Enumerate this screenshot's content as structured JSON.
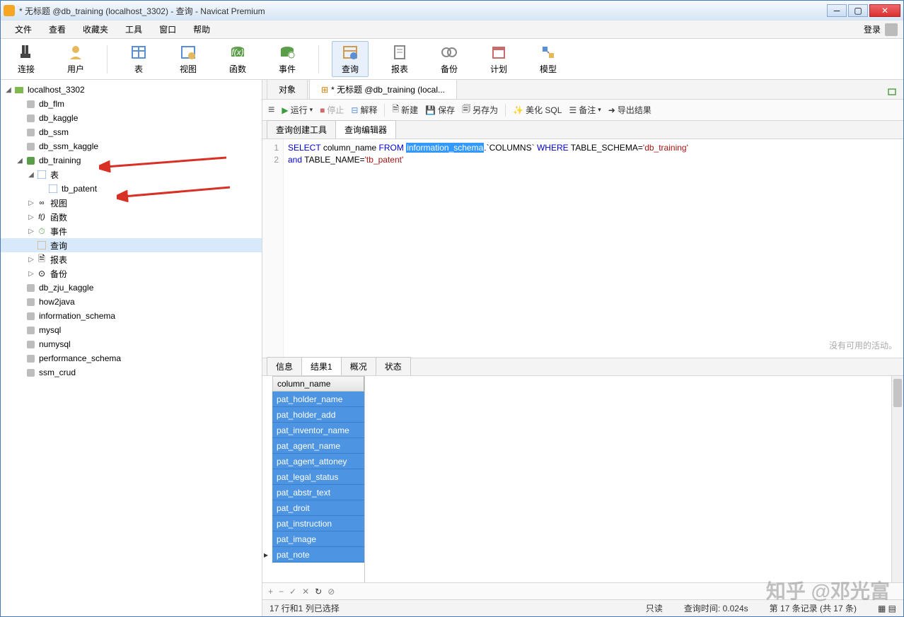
{
  "window": {
    "title": "* 无标题 @db_training (localhost_3302) - 查询 - Navicat Premium"
  },
  "menu": [
    "文件",
    "查看",
    "收藏夹",
    "工具",
    "窗口",
    "帮助"
  ],
  "login_label": "登录",
  "toolbar": [
    {
      "label": "连接",
      "icon": "plug"
    },
    {
      "label": "用户",
      "icon": "user"
    },
    {
      "label": "表",
      "icon": "table"
    },
    {
      "label": "视图",
      "icon": "view"
    },
    {
      "label": "函数",
      "icon": "fx"
    },
    {
      "label": "事件",
      "icon": "event"
    },
    {
      "label": "查询",
      "icon": "query",
      "active": true
    },
    {
      "label": "报表",
      "icon": "report"
    },
    {
      "label": "备份",
      "icon": "backup"
    },
    {
      "label": "计划",
      "icon": "schedule"
    },
    {
      "label": "模型",
      "icon": "model"
    }
  ],
  "tree": {
    "conn": "localhost_3302",
    "dbs_before": [
      "db_flm",
      "db_kaggle",
      "db_ssm",
      "db_ssm_kaggle"
    ],
    "active_db": "db_training",
    "active_nodes": {
      "tables_label": "表",
      "table_name": "tb_patent",
      "views": "视图",
      "functions": "函数",
      "events": "事件",
      "queries": "查询",
      "reports": "报表",
      "backups": "备份"
    },
    "dbs_after": [
      "db_zju_kaggle",
      "how2java",
      "information_schema",
      "mysql",
      "numysql",
      "performance_schema",
      "ssm_crud"
    ]
  },
  "main_tabs": {
    "objects": "对象",
    "query": "* 无标题 @db_training (local..."
  },
  "qtoolbar": {
    "run": "运行",
    "stop": "停止",
    "explain": "解释",
    "new": "新建",
    "save": "保存",
    "saveas": "另存为",
    "beautify": "美化 SQL",
    "notes": "备注",
    "export": "导出结果"
  },
  "subtabs": {
    "builder": "查询创建工具",
    "editor": "查询编辑器"
  },
  "sql": {
    "line1_a": "SELECT",
    "line1_b": "column_name",
    "line1_c": "FROM",
    "line1_hl": "information_schema",
    "line1_d": ".`COLUMNS`",
    "line1_e": "WHERE",
    "line1_f": "TABLE_SCHEMA=",
    "line1_g": "'db_training'",
    "line2_a": "and",
    "line2_b": "TABLE_NAME=",
    "line2_c": "'tb_patent'"
  },
  "result_tabs": [
    "信息",
    "结果1",
    "概况",
    "状态"
  ],
  "result_header": "column_name",
  "result_rows": [
    "pat_holder_name",
    "pat_holder_add",
    "pat_inventor_name",
    "pat_agent_name",
    "pat_agent_attoney",
    "pat_legal_status",
    "pat_abstr_text",
    "pat_droit",
    "pat_instruction",
    "pat_image",
    "pat_note"
  ],
  "right_hint": "没有可用的活动。",
  "status": {
    "sel": "17 行和1 列已选择",
    "ro": "只读",
    "time": "查询时间: 0.024s",
    "rec": "第 17 条记录 (共 17 条)"
  },
  "watermark": "知乎 @邓光富"
}
